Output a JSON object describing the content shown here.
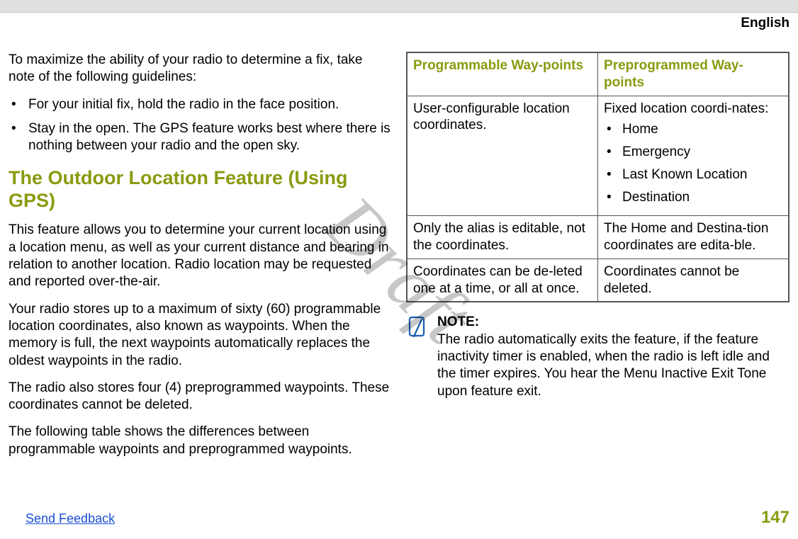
{
  "header": {
    "language": "English"
  },
  "watermark": "Draft",
  "left": {
    "intro": "To maximize the ability of your radio to determine a fix, take note of the following guidelines:",
    "guidelines": [
      "For your initial fix, hold the radio in the face position.",
      "Stay in the open. The GPS feature works best where there is nothing between your radio and the open sky."
    ],
    "heading": "The Outdoor Location Feature (Using GPS)",
    "p1": "This feature allows you to determine your current location using a location menu, as well as your current distance and bearing in relation to another location. Radio location may be requested and reported over-the-air.",
    "p2": "Your radio stores up to a maximum of sixty (60) programmable location coordinates, also known as waypoints. When the memory is full, the next waypoints automatically replaces the oldest waypoints in the radio.",
    "p3": "The radio also stores four (4) preprogrammed waypoints. These coordinates cannot be deleted.",
    "p4": "The following table shows the differences between programmable waypoints and preprogrammed waypoints."
  },
  "right": {
    "table": {
      "head": {
        "prog": "Programmable Way-points",
        "preprog": "Preprogrammed Way-points"
      },
      "r1": {
        "prog": "User-configurable location coordinates.",
        "preprog_lead": "Fixed location coordi-nates:",
        "preprog_items": [
          "Home",
          "Emergency",
          "Last Known Location",
          "Destination"
        ]
      },
      "r2": {
        "prog": "Only the alias is editable, not the coordinates.",
        "preprog": "The Home and Destina-tion coordinates are edita-ble."
      },
      "r3": {
        "prog": "Coordinates can be de-leted one at a time, or all at once.",
        "preprog": "Coordinates cannot be deleted."
      }
    },
    "note": {
      "title": "NOTE:",
      "body": "The radio automatically exits the feature, if the feature inactivity timer is enabled, when the radio is left idle and the timer expires. You hear the Menu Inactive Exit Tone upon feature exit."
    }
  },
  "footer": {
    "feedback": "Send Feedback",
    "page": "147"
  }
}
